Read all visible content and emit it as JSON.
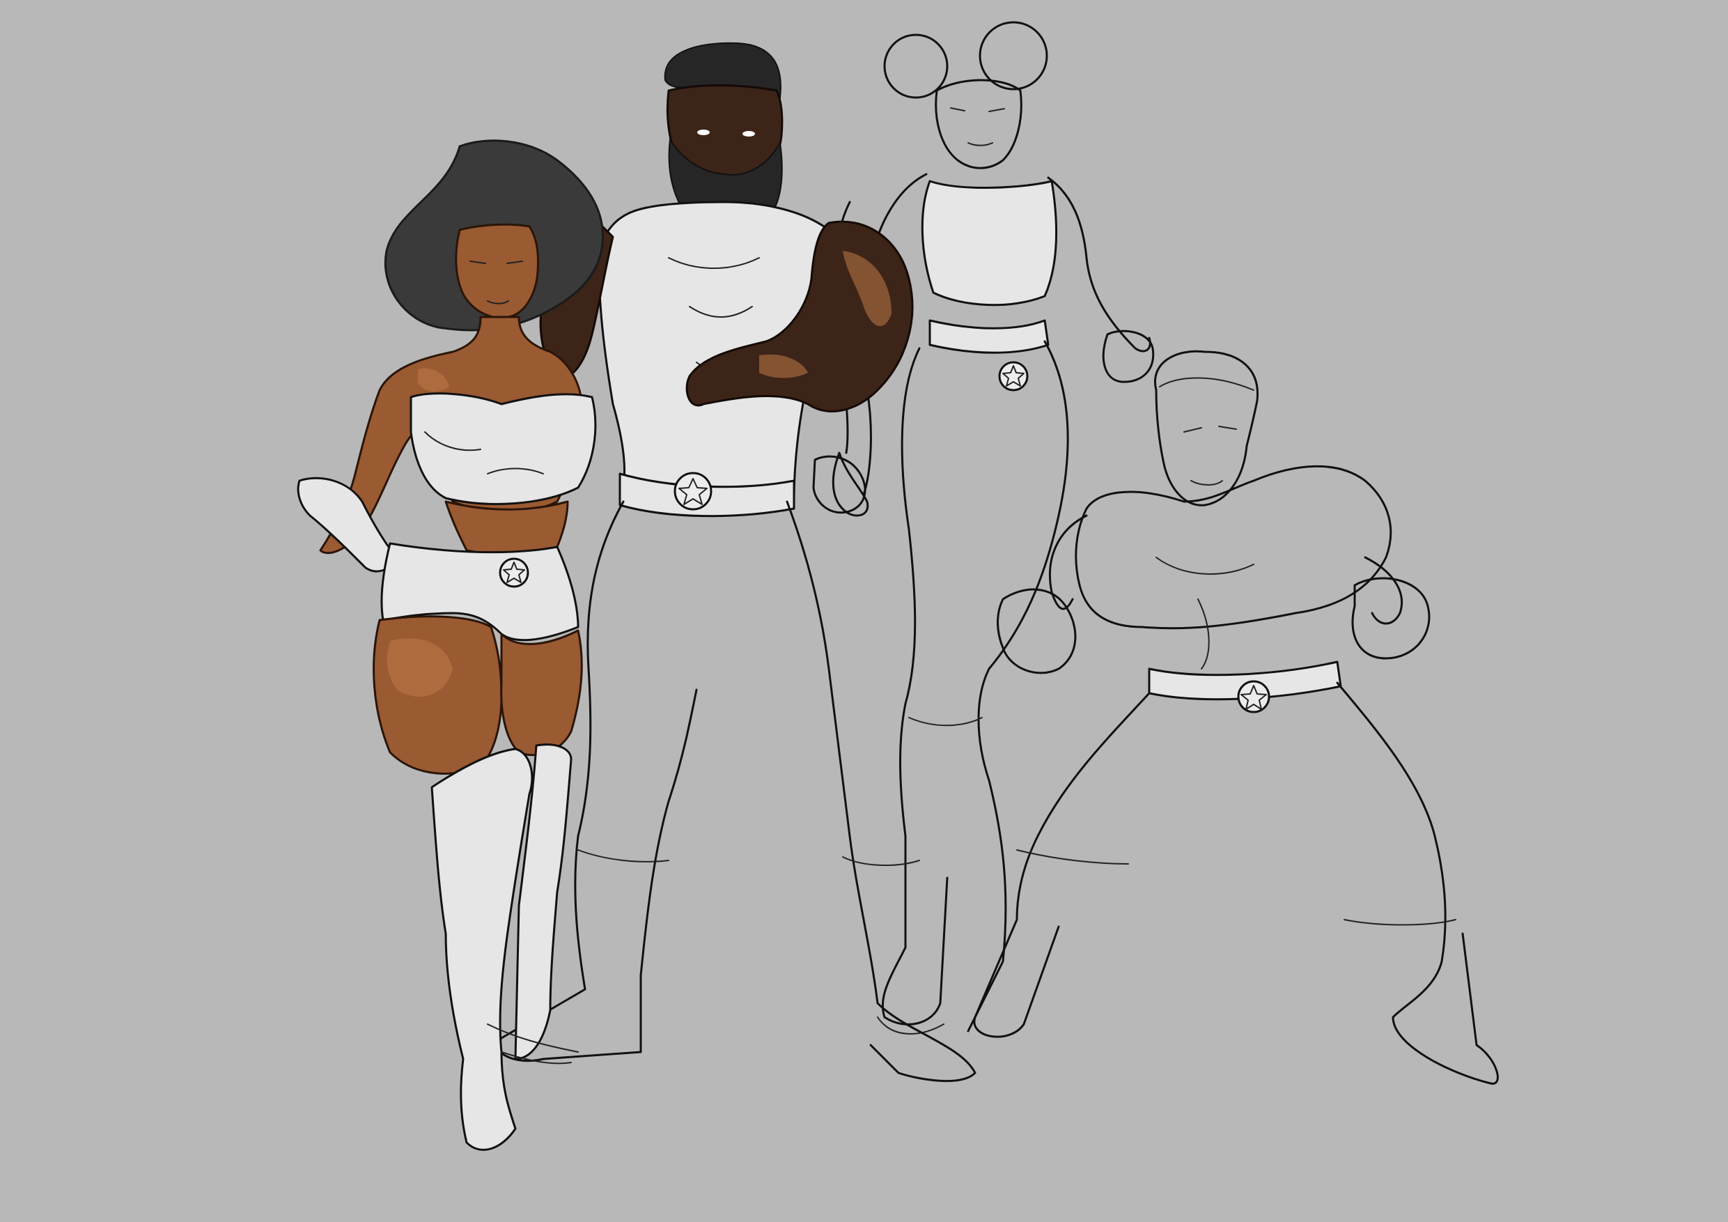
{
  "canvas": {
    "background": "#b8b8b8"
  },
  "figures": [
    {
      "id": "woman-afro",
      "stage": "colored",
      "skin": "#9a5a32",
      "suit": "#e6e6e6",
      "hair": "#3a3a3a"
    },
    {
      "id": "bearded-man",
      "stage": "partially-colored",
      "skin": "#3c2418",
      "suit": "#e6e6e6",
      "hair": "#262626"
    },
    {
      "id": "woman-puffs",
      "stage": "line-art"
    },
    {
      "id": "young-man",
      "stage": "line-art"
    }
  ],
  "emblem_icon": "star-icon"
}
